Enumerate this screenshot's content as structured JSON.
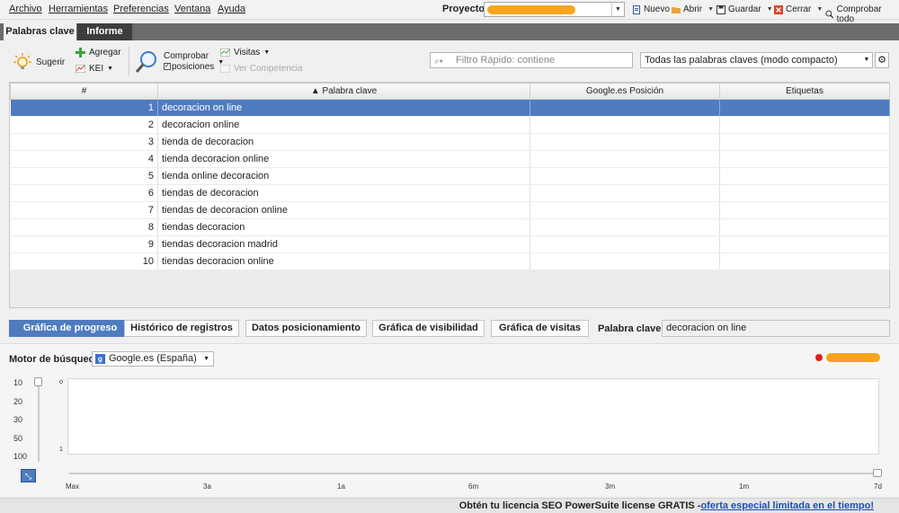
{
  "menu": [
    "Archivo",
    "Herramientas",
    "Preferencias",
    "Ventana",
    "Ayuda"
  ],
  "project": {
    "label": "Proyecto:",
    "buttons": {
      "new": "Nuevo",
      "open": "Abrir",
      "save": "Guardar",
      "close": "Cerrar",
      "check_all": "Comprobar todo"
    }
  },
  "tabs": [
    "Palabras clave",
    "Informe"
  ],
  "toolbar": {
    "suggest": "Sugerir",
    "add": "Agregar",
    "kei": "KEI",
    "check_positions_1": "Comprobar",
    "check_positions_2": "posiciones",
    "visits": "Visitas",
    "see_competition": "Ver Competencia",
    "filter_placeholder": "Filtro Rápido: contiene",
    "view_select": "Todas las palabras claves (modo compacto)"
  },
  "table": {
    "headers": [
      "#",
      "▲ Palabra clave",
      "Google.es Posición",
      "Etiquetas"
    ],
    "rows": [
      {
        "n": "1",
        "kw": "decoracion on line"
      },
      {
        "n": "2",
        "kw": "decoracion online"
      },
      {
        "n": "3",
        "kw": "tienda de decoracion"
      },
      {
        "n": "4",
        "kw": "tienda decoracion online"
      },
      {
        "n": "5",
        "kw": "tienda online decoracion"
      },
      {
        "n": "6",
        "kw": "tiendas de decoracion"
      },
      {
        "n": "7",
        "kw": "tiendas de decoracion online"
      },
      {
        "n": "8",
        "kw": "tiendas decoracion"
      },
      {
        "n": "9",
        "kw": "tiendas decoracion madrid"
      },
      {
        "n": "10",
        "kw": "tiendas decoracion online"
      }
    ]
  },
  "bottom_tabs": [
    "Gráfica de progreso",
    "Histórico de registros",
    "Datos posicionamiento",
    "Gráfica de visibilidad",
    "Gráfica de visitas"
  ],
  "keyword_label": "Palabra clave:",
  "keyword_value": "decoracion on line",
  "chart": {
    "engine_label": "Motor de búsqueda:",
    "engine_value": "Google.es (España)",
    "y_ticks": [
      "10",
      "20",
      "30",
      "50",
      "100"
    ],
    "plot_labels": [
      "o",
      "1"
    ],
    "x_ticks": [
      "Max",
      "3a",
      "1a",
      "6m",
      "3m",
      "1m",
      "7d"
    ]
  },
  "promo": {
    "text": "Obtén tu licencia SEO PowerSuite license GRATIS -",
    "link": "oferta especial limitada en el tiempo!"
  },
  "colors": {
    "accent": "#4f7cbf",
    "redact": "#f7a51e",
    "legend": "#e02020"
  }
}
